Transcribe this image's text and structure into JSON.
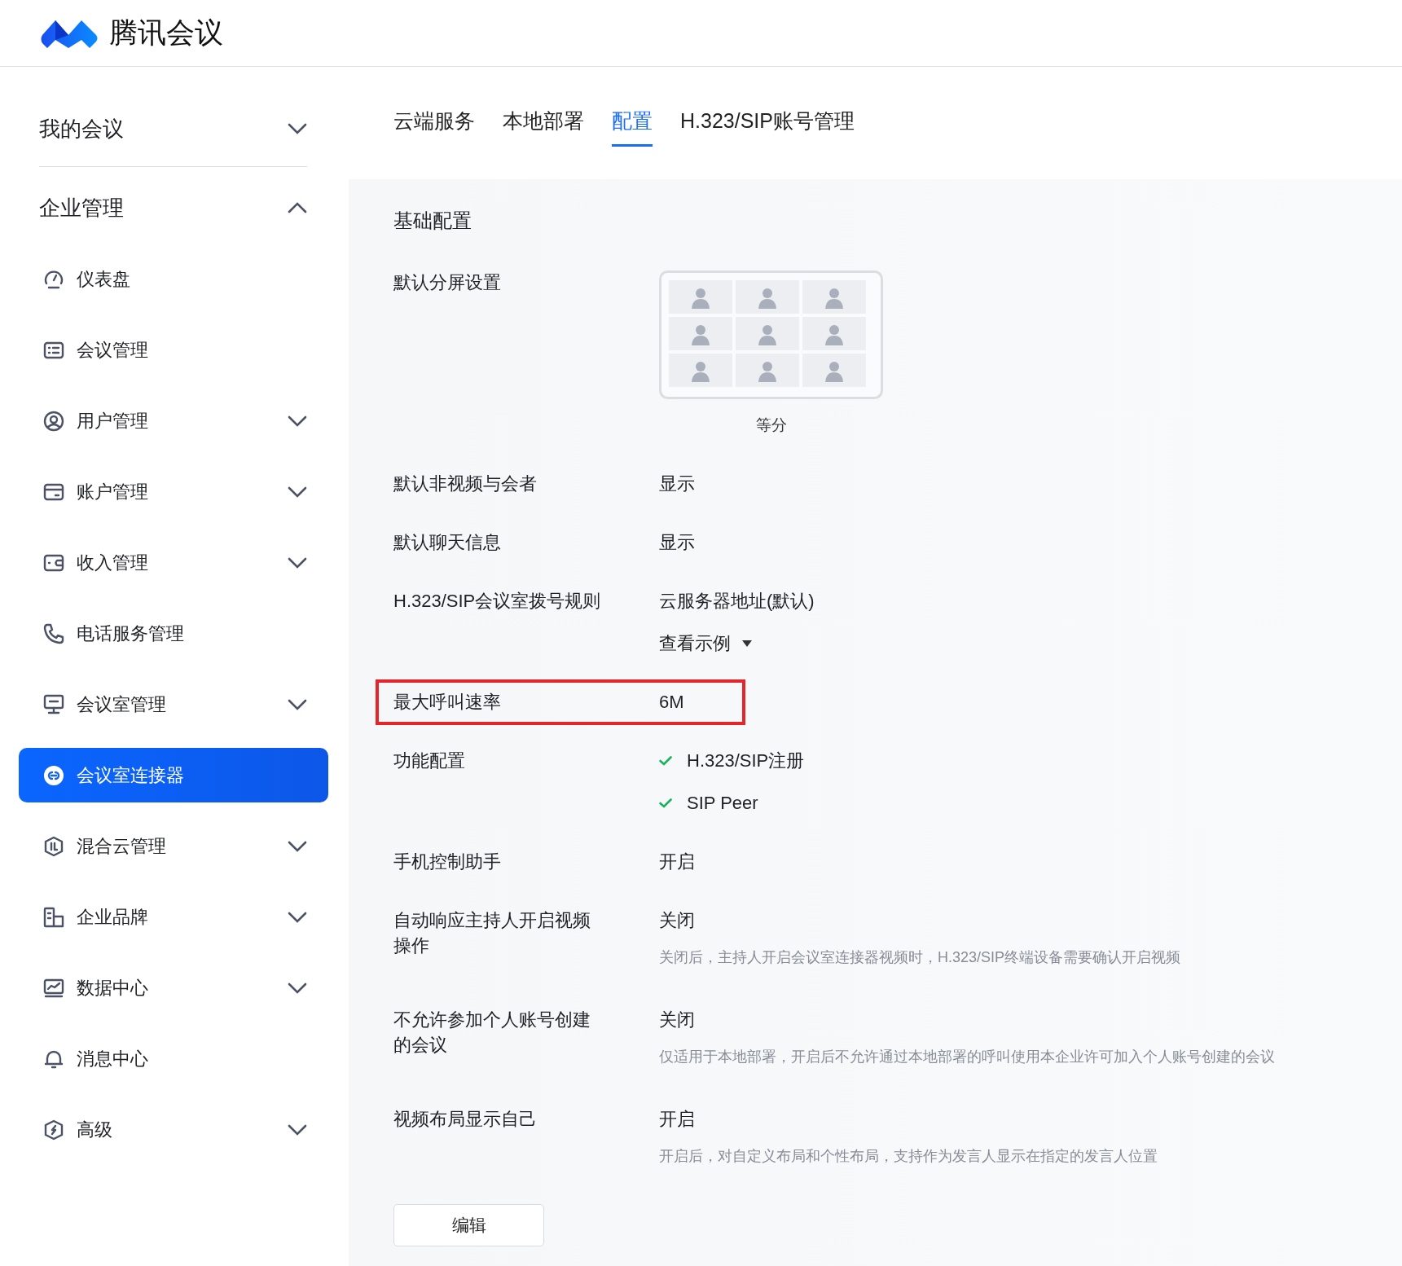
{
  "logo": {
    "text": "腾讯会议"
  },
  "sidebar": {
    "sections": [
      {
        "label": "我的会议",
        "expanded": false
      },
      {
        "label": "企业管理",
        "expanded": true,
        "items": [
          {
            "label": "仪表盘",
            "has_submenu": false,
            "selected": false
          },
          {
            "label": "会议管理",
            "has_submenu": false,
            "selected": false
          },
          {
            "label": "用户管理",
            "has_submenu": true,
            "selected": false
          },
          {
            "label": "账户管理",
            "has_submenu": true,
            "selected": false
          },
          {
            "label": "收入管理",
            "has_submenu": true,
            "selected": false
          },
          {
            "label": "电话服务管理",
            "has_submenu": false,
            "selected": false
          },
          {
            "label": "会议室管理",
            "has_submenu": true,
            "selected": false
          },
          {
            "label": "会议室连接器",
            "has_submenu": false,
            "selected": true
          },
          {
            "label": "混合云管理",
            "has_submenu": true,
            "selected": false
          },
          {
            "label": "企业品牌",
            "has_submenu": true,
            "selected": false
          },
          {
            "label": "数据中心",
            "has_submenu": true,
            "selected": false
          },
          {
            "label": "消息中心",
            "has_submenu": false,
            "selected": false
          },
          {
            "label": "高级",
            "has_submenu": true,
            "selected": false
          }
        ]
      }
    ]
  },
  "tabs": [
    {
      "label": "云端服务",
      "selected": false
    },
    {
      "label": "本地部署",
      "selected": false
    },
    {
      "label": "配置",
      "selected": true
    },
    {
      "label": "H.323/SIP账号管理",
      "selected": false
    }
  ],
  "section_title": "基础配置",
  "settings": [
    {
      "kind": "layout",
      "label": "默认分屏设置",
      "caption": "等分",
      "highlighted": false
    },
    {
      "kind": "text",
      "label": "默认非视频与会者",
      "value": "显示",
      "highlighted": false
    },
    {
      "kind": "text",
      "label": "默认聊天信息",
      "value": "显示",
      "highlighted": false
    },
    {
      "kind": "text",
      "label": "H.323/SIP会议室拨号规则",
      "value": "云服务器地址(默认)",
      "link": "查看示例",
      "highlighted": false
    },
    {
      "kind": "text",
      "label": "最大呼叫速率",
      "value": "6M",
      "highlighted": true
    },
    {
      "kind": "checks",
      "label": "功能配置",
      "highlighted": false,
      "options": [
        {
          "label": "H.323/SIP注册",
          "checked": true
        },
        {
          "label": "SIP Peer",
          "checked": true
        }
      ]
    },
    {
      "kind": "text",
      "label": "手机控制助手",
      "value": "开启",
      "highlighted": false
    },
    {
      "kind": "text",
      "label": "自动响应主持人开启视频操作",
      "value": "关闭",
      "note": "关闭后，主持人开启会议室连接器视频时，H.323/SIP终端设备需要确认开启视频",
      "highlighted": false
    },
    {
      "kind": "text",
      "label": "不允许参加个人账号创建的会议",
      "value": "关闭",
      "note": "仅适用于本地部署，开启后不允许通过本地部署的呼叫使用本企业许可加入个人账号创建的会议",
      "highlighted": false
    },
    {
      "kind": "text",
      "label": "视频布局显示自己",
      "value": "开启",
      "note": "开启后，对自定义布局和个性布局，支持作为发言人显示在指定的发言人位置",
      "highlighted": false
    }
  ],
  "edit_button": "编辑"
}
